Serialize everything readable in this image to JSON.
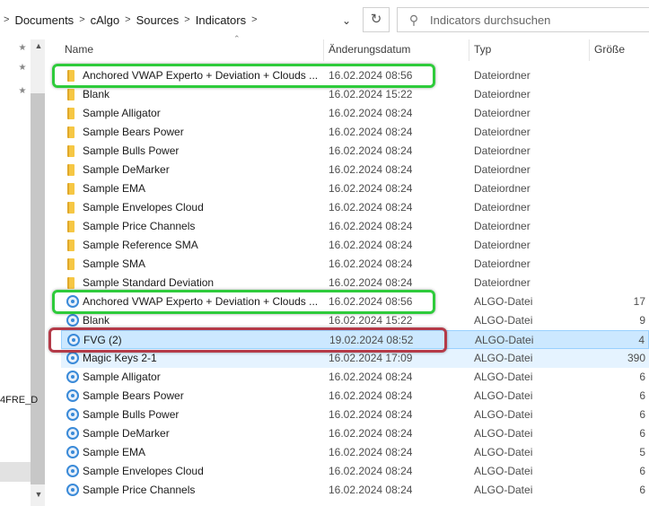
{
  "breadcrumb": [
    "Documents",
    "cAlgo",
    "Sources",
    "Indicators"
  ],
  "search": {
    "placeholder": "Indicators durchsuchen"
  },
  "nav": {
    "fragment": "4FRE_D"
  },
  "columns": {
    "name": "Name",
    "date": "Änderungsdatum",
    "type": "Typ",
    "size": "Größe"
  },
  "colors": {
    "selection": "#cce8ff",
    "highlight_green": "#2ecb3b",
    "highlight_red": "#b43a48",
    "folder": "#f6c744",
    "algo": "#3a8ad8"
  },
  "files": [
    {
      "name": "Anchored VWAP Experto + Deviation + Clouds ...",
      "date": "16.02.2024 08:56",
      "type": "Dateiordner",
      "size": "",
      "icon": "folder-icon"
    },
    {
      "name": "Blank",
      "date": "16.02.2024 15:22",
      "type": "Dateiordner",
      "size": "",
      "icon": "folder-icon"
    },
    {
      "name": "Sample Alligator",
      "date": "16.02.2024 08:24",
      "type": "Dateiordner",
      "size": "",
      "icon": "folder-icon"
    },
    {
      "name": "Sample Bears Power",
      "date": "16.02.2024 08:24",
      "type": "Dateiordner",
      "size": "",
      "icon": "folder-icon"
    },
    {
      "name": "Sample Bulls Power",
      "date": "16.02.2024 08:24",
      "type": "Dateiordner",
      "size": "",
      "icon": "folder-icon"
    },
    {
      "name": "Sample DeMarker",
      "date": "16.02.2024 08:24",
      "type": "Dateiordner",
      "size": "",
      "icon": "folder-icon"
    },
    {
      "name": "Sample EMA",
      "date": "16.02.2024 08:24",
      "type": "Dateiordner",
      "size": "",
      "icon": "folder-icon"
    },
    {
      "name": "Sample Envelopes Cloud",
      "date": "16.02.2024 08:24",
      "type": "Dateiordner",
      "size": "",
      "icon": "folder-icon"
    },
    {
      "name": "Sample Price Channels",
      "date": "16.02.2024 08:24",
      "type": "Dateiordner",
      "size": "",
      "icon": "folder-icon"
    },
    {
      "name": "Sample Reference SMA",
      "date": "16.02.2024 08:24",
      "type": "Dateiordner",
      "size": "",
      "icon": "folder-icon"
    },
    {
      "name": "Sample SMA",
      "date": "16.02.2024 08:24",
      "type": "Dateiordner",
      "size": "",
      "icon": "folder-icon"
    },
    {
      "name": "Sample Standard Deviation",
      "date": "16.02.2024 08:24",
      "type": "Dateiordner",
      "size": "",
      "icon": "folder-icon"
    },
    {
      "name": "Anchored VWAP Experto + Deviation + Clouds ...",
      "date": "16.02.2024 08:56",
      "type": "ALGO-Datei",
      "size": "17",
      "icon": "algo-file-icon"
    },
    {
      "name": "Blank",
      "date": "16.02.2024 15:22",
      "type": "ALGO-Datei",
      "size": "9",
      "icon": "algo-file-icon"
    },
    {
      "name": "FVG (2)",
      "date": "19.02.2024 08:52",
      "type": "ALGO-Datei",
      "size": "4",
      "icon": "algo-file-icon"
    },
    {
      "name": "Magic Keys 2-1",
      "date": "16.02.2024 17:09",
      "type": "ALGO-Datei",
      "size": "390",
      "icon": "algo-file-icon"
    },
    {
      "name": "Sample Alligator",
      "date": "16.02.2024 08:24",
      "type": "ALGO-Datei",
      "size": "6",
      "icon": "algo-file-icon"
    },
    {
      "name": "Sample Bears Power",
      "date": "16.02.2024 08:24",
      "type": "ALGO-Datei",
      "size": "6",
      "icon": "algo-file-icon"
    },
    {
      "name": "Sample Bulls Power",
      "date": "16.02.2024 08:24",
      "type": "ALGO-Datei",
      "size": "6",
      "icon": "algo-file-icon"
    },
    {
      "name": "Sample DeMarker",
      "date": "16.02.2024 08:24",
      "type": "ALGO-Datei",
      "size": "6",
      "icon": "algo-file-icon"
    },
    {
      "name": "Sample EMA",
      "date": "16.02.2024 08:24",
      "type": "ALGO-Datei",
      "size": "5",
      "icon": "algo-file-icon"
    },
    {
      "name": "Sample Envelopes Cloud",
      "date": "16.02.2024 08:24",
      "type": "ALGO-Datei",
      "size": "6",
      "icon": "algo-file-icon"
    },
    {
      "name": "Sample Price Channels",
      "date": "16.02.2024 08:24",
      "type": "ALGO-Datei",
      "size": "6",
      "icon": "algo-file-icon"
    }
  ]
}
